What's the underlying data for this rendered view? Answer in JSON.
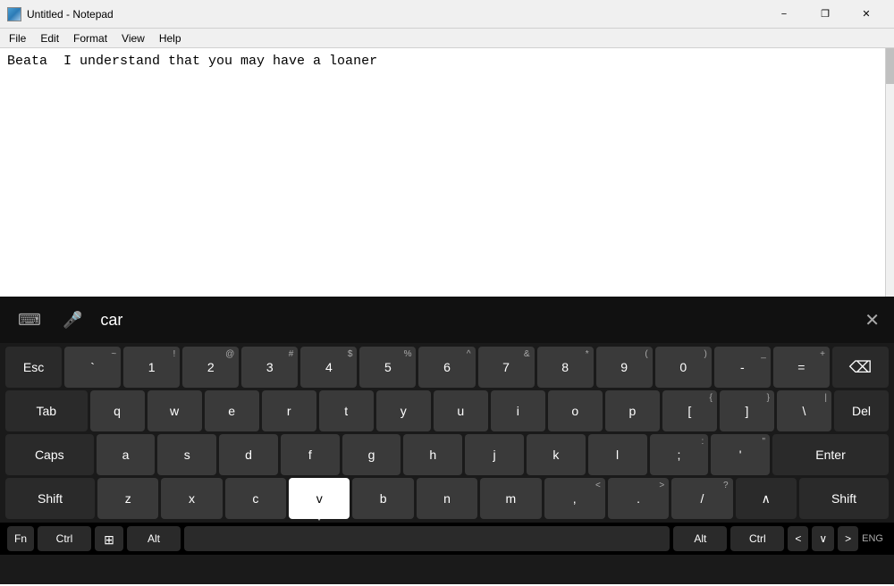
{
  "titlebar": {
    "title": "Untitled - Notepad",
    "minimize_label": "−",
    "maximize_label": "❐",
    "close_label": "✕"
  },
  "menubar": {
    "items": [
      "File",
      "Edit",
      "Format",
      "View",
      "Help"
    ]
  },
  "editor": {
    "content": "Beata  I understand that you may have a loaner"
  },
  "keyboard_toolbar": {
    "search_text": "car",
    "close_label": "✕",
    "keyboard_icon": "⌨",
    "mic_icon": "🎤"
  },
  "keyboard": {
    "rows": [
      {
        "keys": [
          {
            "label": "Esc",
            "shift": "",
            "type": "special"
          },
          {
            "label": "`",
            "shift": "~",
            "type": "normal"
          },
          {
            "label": "1",
            "shift": "!",
            "type": "normal"
          },
          {
            "label": "2",
            "shift": "@",
            "type": "normal"
          },
          {
            "label": "3",
            "shift": "#",
            "type": "normal"
          },
          {
            "label": "4",
            "shift": "$",
            "type": "normal"
          },
          {
            "label": "5",
            "shift": "%",
            "type": "normal"
          },
          {
            "label": "6",
            "shift": "^",
            "type": "normal"
          },
          {
            "label": "7",
            "shift": "&",
            "type": "normal"
          },
          {
            "label": "8",
            "shift": "*",
            "type": "normal"
          },
          {
            "label": "9",
            "shift": "(",
            "type": "normal"
          },
          {
            "label": "0",
            "shift": ")",
            "type": "normal"
          },
          {
            "label": "-",
            "shift": "_",
            "type": "normal"
          },
          {
            "label": "=",
            "shift": "+",
            "type": "normal"
          },
          {
            "label": "⌫",
            "shift": "",
            "type": "backspace"
          }
        ]
      },
      {
        "keys": [
          {
            "label": "Tab",
            "shift": "",
            "type": "special wide"
          },
          {
            "label": "q",
            "shift": "",
            "type": "normal"
          },
          {
            "label": "w",
            "shift": "",
            "type": "normal"
          },
          {
            "label": "e",
            "shift": "",
            "type": "normal"
          },
          {
            "label": "r",
            "shift": "",
            "type": "normal"
          },
          {
            "label": "t",
            "shift": "",
            "type": "normal"
          },
          {
            "label": "y",
            "shift": "",
            "type": "normal"
          },
          {
            "label": "u",
            "shift": "",
            "type": "normal"
          },
          {
            "label": "i",
            "shift": "",
            "type": "normal"
          },
          {
            "label": "o",
            "shift": "",
            "type": "normal"
          },
          {
            "label": "p",
            "shift": "",
            "type": "normal"
          },
          {
            "label": "[",
            "shift": "{",
            "type": "normal"
          },
          {
            "label": "]",
            "shift": "}",
            "type": "normal"
          },
          {
            "label": "\\",
            "shift": "|",
            "type": "normal"
          },
          {
            "label": "Del",
            "shift": "",
            "type": "special"
          }
        ]
      },
      {
        "keys": [
          {
            "label": "Caps",
            "shift": "",
            "type": "special wide"
          },
          {
            "label": "a",
            "shift": "",
            "type": "normal"
          },
          {
            "label": "s",
            "shift": "",
            "type": "normal"
          },
          {
            "label": "d",
            "shift": "",
            "type": "normal"
          },
          {
            "label": "f",
            "shift": "",
            "type": "normal"
          },
          {
            "label": "g",
            "shift": "",
            "type": "normal"
          },
          {
            "label": "h",
            "shift": "",
            "type": "normal"
          },
          {
            "label": "j",
            "shift": "",
            "type": "normal"
          },
          {
            "label": "k",
            "shift": "",
            "type": "normal"
          },
          {
            "label": "l",
            "shift": "",
            "type": "normal"
          },
          {
            "label": ";",
            "shift": ":",
            "type": "normal"
          },
          {
            "label": "'",
            "shift": "\"",
            "type": "normal"
          },
          {
            "label": "Enter",
            "shift": "",
            "type": "special wider"
          }
        ]
      },
      {
        "keys": [
          {
            "label": "Shift",
            "shift": "",
            "type": "special wide"
          },
          {
            "label": "z",
            "shift": "",
            "type": "normal"
          },
          {
            "label": "x",
            "shift": "",
            "type": "normal"
          },
          {
            "label": "c",
            "shift": "",
            "type": "normal"
          },
          {
            "label": "v",
            "shift": "",
            "type": "highlighted"
          },
          {
            "label": "b",
            "shift": "",
            "type": "normal"
          },
          {
            "label": "n",
            "shift": "",
            "type": "normal"
          },
          {
            "label": "m",
            "shift": "",
            "type": "normal"
          },
          {
            "label": ",",
            "shift": "<",
            "type": "normal"
          },
          {
            "label": ".",
            "shift": ">",
            "type": "normal"
          },
          {
            "label": "/",
            "shift": "?",
            "type": "normal"
          },
          {
            "label": "∧",
            "shift": "",
            "type": "special"
          },
          {
            "label": "Shift",
            "shift": "",
            "type": "special wide"
          }
        ]
      }
    ],
    "bottom_row": {
      "fn": "Fn",
      "ctrl_left": "Ctrl",
      "alt_left": "Alt",
      "space": " ",
      "alt_right": "Alt",
      "ctrl_right": "Ctrl",
      "left": "<",
      "down": "∨",
      "right": ">",
      "eng": "ENG"
    }
  }
}
